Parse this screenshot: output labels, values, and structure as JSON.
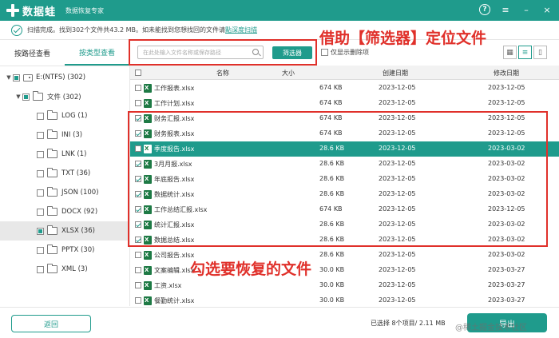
{
  "app": {
    "name": "数据蛙",
    "subtitle": "数据恢复专家",
    "window_controls": {
      "help": "?",
      "menu": "≡",
      "minimize": "–",
      "close": "×"
    }
  },
  "status": {
    "text": "扫描完成。找到302个文件共43.2 MB。如未能找到您想找回的文件请",
    "link": "點深度扫描"
  },
  "left_panel": {
    "tabs": [
      {
        "label": "按路径查看",
        "active": false
      },
      {
        "label": "按类型查看",
        "active": true
      }
    ],
    "tree": [
      {
        "label": "E:(NTFS) (302)",
        "type": "drive"
      },
      {
        "label": "文件 (302)",
        "type": "folder"
      },
      {
        "label": "LOG (1)",
        "type": "folder"
      },
      {
        "label": "INI (3)",
        "type": "folder"
      },
      {
        "label": "LNK (1)",
        "type": "folder"
      },
      {
        "label": "TXT (36)",
        "type": "folder"
      },
      {
        "label": "JSON (100)",
        "type": "folder"
      },
      {
        "label": "DOCX (92)",
        "type": "folder"
      },
      {
        "label": "XLSX (36)",
        "type": "folder",
        "selected": true
      },
      {
        "label": "PPTX (30)",
        "type": "folder"
      },
      {
        "label": "XML (3)",
        "type": "folder"
      }
    ]
  },
  "toolbar": {
    "search_placeholder": "在此处输入文件名称或保存路径",
    "filter_button": "筛选器",
    "only_deleted": "仅显示删除项"
  },
  "table": {
    "columns": [
      "名称",
      "大小",
      "创建日期",
      "修改日期"
    ],
    "rows": [
      {
        "name": "工作报表.xlsx",
        "size": "674 KB",
        "created": "2023-12-05",
        "modified": "2023-12-05",
        "checked": false,
        "highlight": false
      },
      {
        "name": "工作计划.xlsx",
        "size": "674 KB",
        "created": "2023-12-05",
        "modified": "2023-12-05",
        "checked": false,
        "highlight": false
      },
      {
        "name": "财务汇报.xlsx",
        "size": "674 KB",
        "created": "2023-12-05",
        "modified": "2023-12-05",
        "checked": true,
        "highlight": false
      },
      {
        "name": "财务报表.xlsx",
        "size": "674 KB",
        "created": "2023-12-05",
        "modified": "2023-12-05",
        "checked": true,
        "highlight": false
      },
      {
        "name": "季度报告.xlsx",
        "size": "28.6 KB",
        "created": "2023-12-05",
        "modified": "2023-03-02",
        "checked": false,
        "highlight": true
      },
      {
        "name": "3月月报.xlsx",
        "size": "28.6 KB",
        "created": "2023-12-05",
        "modified": "2023-03-02",
        "checked": true,
        "highlight": false
      },
      {
        "name": "年底报告.xlsx",
        "size": "28.6 KB",
        "created": "2023-12-05",
        "modified": "2023-03-02",
        "checked": true,
        "highlight": false
      },
      {
        "name": "数据统计.xlsx",
        "size": "28.6 KB",
        "created": "2023-12-05",
        "modified": "2023-03-02",
        "checked": true,
        "highlight": false
      },
      {
        "name": "工作总结汇报.xlsx",
        "size": "674 KB",
        "created": "2023-12-05",
        "modified": "2023-12-05",
        "checked": true,
        "highlight": false
      },
      {
        "name": "统计汇报.xlsx",
        "size": "28.6 KB",
        "created": "2023-12-05",
        "modified": "2023-03-02",
        "checked": true,
        "highlight": false
      },
      {
        "name": "数据总结.xlsx",
        "size": "28.6 KB",
        "created": "2023-12-05",
        "modified": "2023-03-02",
        "checked": true,
        "highlight": false
      },
      {
        "name": "公司报告.xlsx",
        "size": "28.6 KB",
        "created": "2023-12-05",
        "modified": "2023-03-02",
        "checked": false,
        "highlight": false
      },
      {
        "name": "文案编辑.xlsx",
        "size": "30.0 KB",
        "created": "2023-12-05",
        "modified": "2023-03-27",
        "checked": false,
        "highlight": false
      },
      {
        "name": "工资.xlsx",
        "size": "30.0 KB",
        "created": "2023-12-05",
        "modified": "2023-03-27",
        "checked": false,
        "highlight": false
      },
      {
        "name": "餐勤统计.xlsx",
        "size": "30.0 KB",
        "created": "2023-12-05",
        "modified": "2023-03-27",
        "checked": false,
        "highlight": false
      }
    ]
  },
  "bottom": {
    "back": "返回",
    "selection_info": "已选择 8个项目/ 2.11 MB",
    "export": "导出"
  },
  "annotations": {
    "filter_hint": "借助【筛选器】定位文件",
    "check_hint": "勾选要恢复的文件"
  },
  "watermark": "@稀土掘金技术社区",
  "colors": {
    "brand": "#1f9b8c",
    "annotation": "#e0302a"
  }
}
